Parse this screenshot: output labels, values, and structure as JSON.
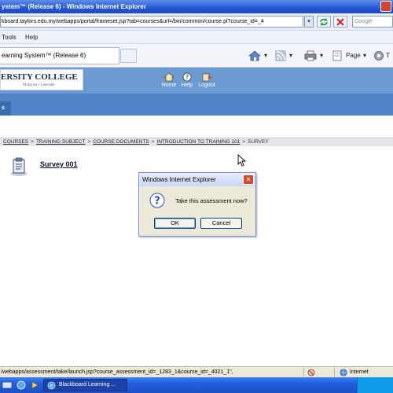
{
  "window": {
    "title": "ystem™ (Release 6) - Windows Internet Explorer"
  },
  "address": {
    "url": "kboard.taylors.edu.my/webapps/portal/frameset.jsp?tab=courses&url=/bin/common/course.pl?course_id=_4",
    "search_placeholder": "Google"
  },
  "menu": {
    "tools": "Tools",
    "help": "Help"
  },
  "tab": {
    "label": "earning System™ (Release 6)"
  },
  "toolbar": {
    "page": "Page",
    "tools": "T"
  },
  "bb": {
    "logo_text": "ERSITY COLLEGE",
    "logo_sub": "Malaysia • Lakeside",
    "nav": {
      "home": "Home",
      "help": "Help",
      "logout": "Logout"
    },
    "tab_chip": "s"
  },
  "breadcrumb": {
    "items": [
      "COURSES",
      "TRAINING SUBJECT",
      "COURSE DOCUMENTS",
      "INTRODUCTION TO TRAINING 101"
    ],
    "current": "SURVEY",
    "separator": ">"
  },
  "content": {
    "item_title": "Survey 001"
  },
  "dialog": {
    "title": "Windows Internet Explorer",
    "message": "Take this assessment now?",
    "ok": "OK",
    "cancel": "Cancel"
  },
  "status": {
    "url": "/webapps/assessment/take/launch.jsp?course_assessment_id=_1283_1&course_id=_4021_1\",",
    "zone": "Internet"
  },
  "taskbar": {
    "task_label": "Blackboard Learning ..."
  }
}
